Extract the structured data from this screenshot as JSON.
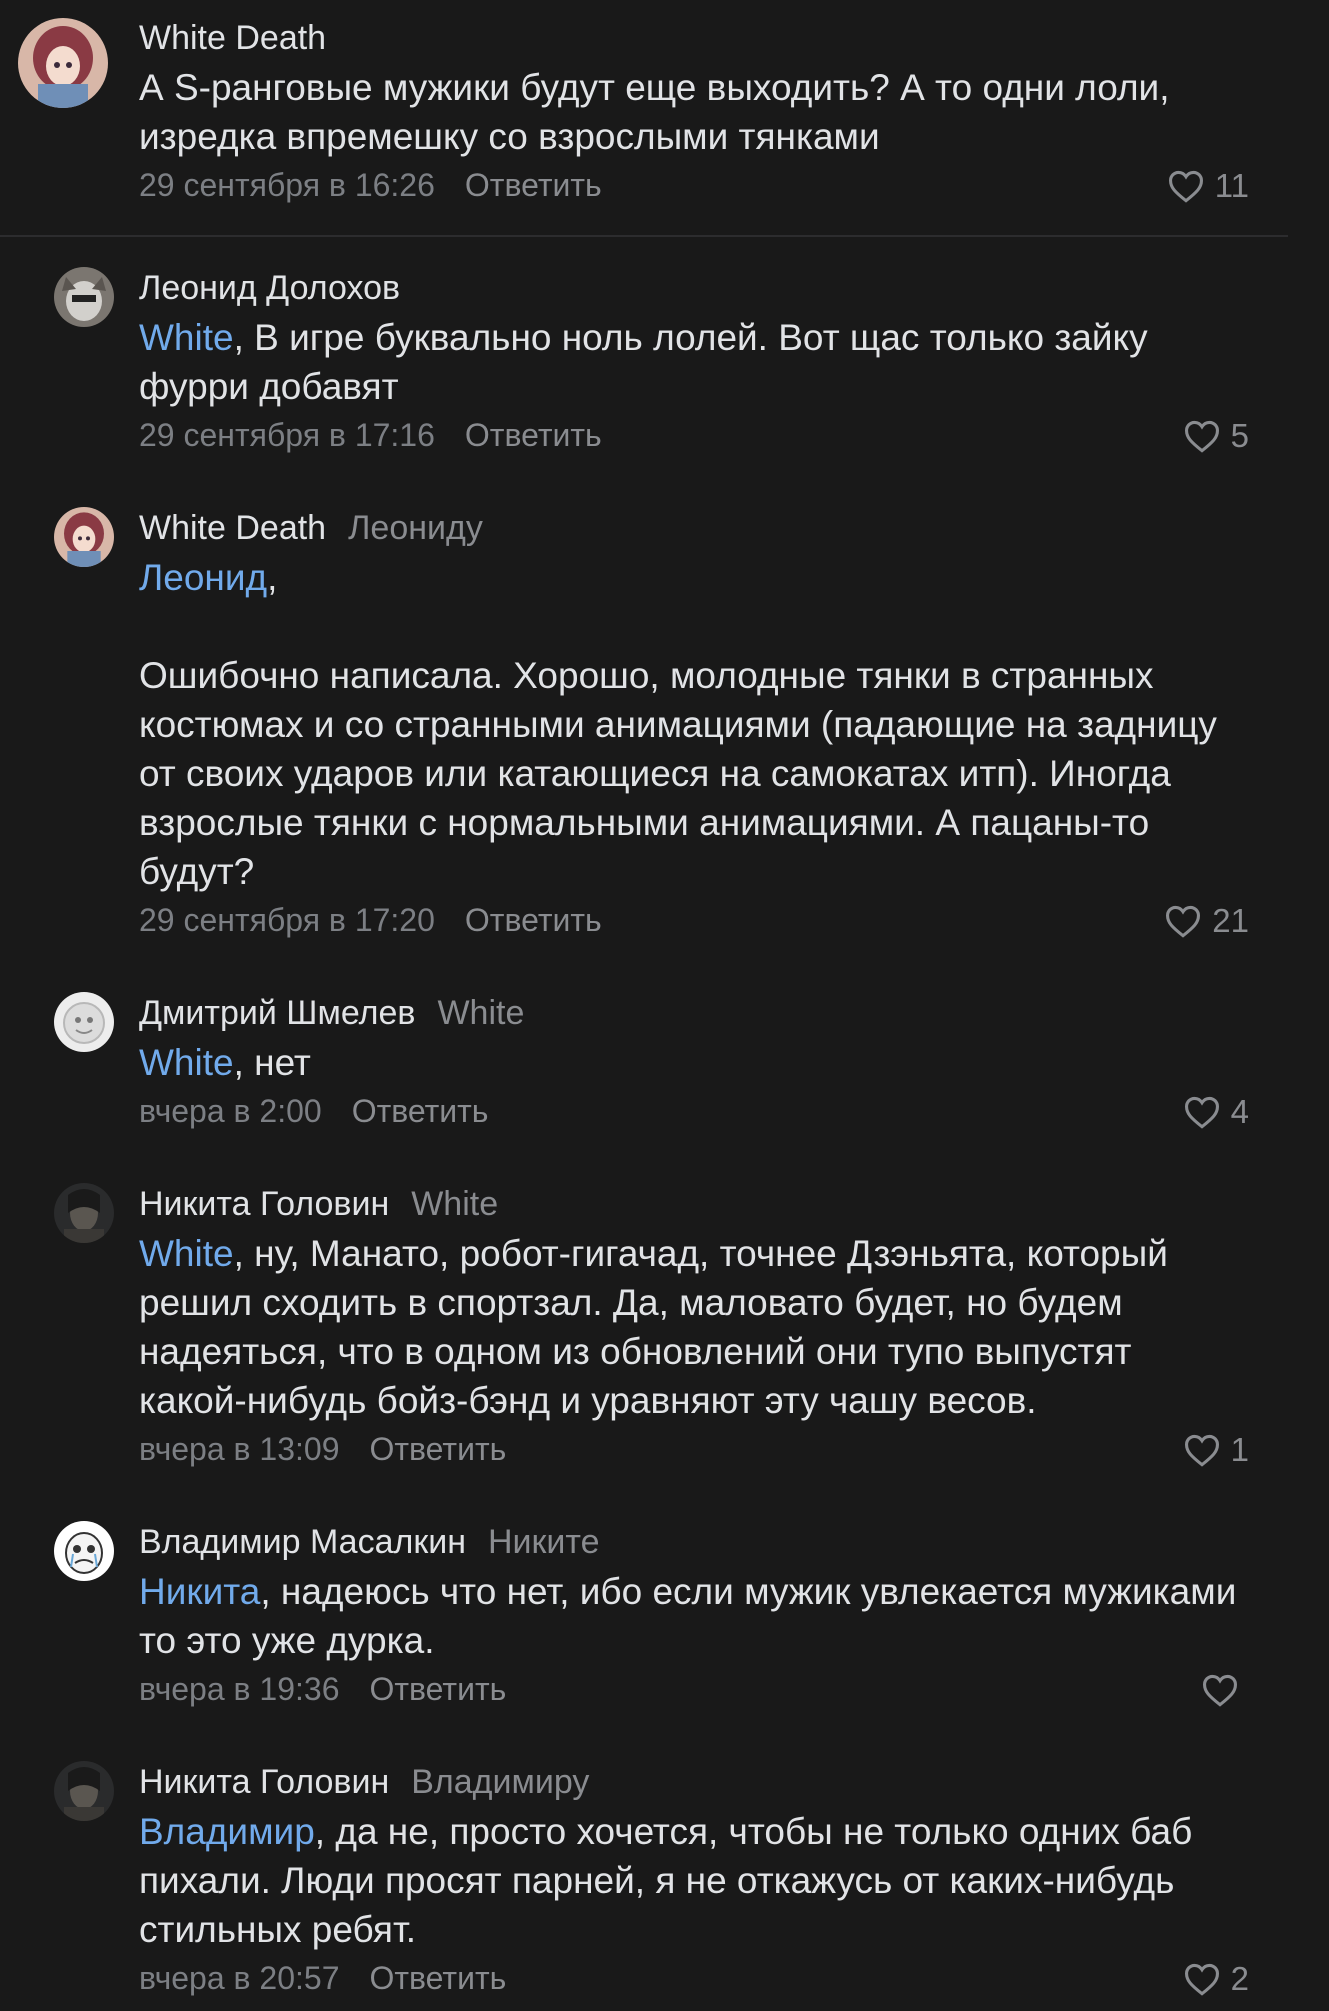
{
  "comments": [
    {
      "author": "White Death",
      "reply_to": "",
      "mention": "",
      "text": "А S-ранговые мужики будут еще выходить? А то одни лоли, изредка впремешку со взрослыми тянками",
      "date": "29 сентября в 16:26",
      "reply_label": "Ответить",
      "likes": "11"
    },
    {
      "author": "Леонид Долохов",
      "reply_to": "",
      "mention": "White",
      "text": ", В игре буквально ноль лолей. Вот щас только зайку фурри добавят",
      "date": "29 сентября в 17:16",
      "reply_label": "Ответить",
      "likes": "5"
    },
    {
      "author": "White Death",
      "reply_to": "Леониду",
      "mention": "Леонид",
      "text": ",\n\nОшибочно написала. Хорошо, молодные тянки в странных костюмах и со странными анимациями (падающие на задницу от своих ударов или катающиеся на самокатах итп). Иногда взрослые тянки с нормальными анимациями. А пацаны-то будут?",
      "date": "29 сентября в 17:20",
      "reply_label": "Ответить",
      "likes": "21"
    },
    {
      "author": "Дмитрий Шмелев",
      "reply_to": "White",
      "mention": "White",
      "text": ", нет",
      "date": "вчера в 2:00",
      "reply_label": "Ответить",
      "likes": "4"
    },
    {
      "author": "Никита Головин",
      "reply_to": "White",
      "mention": "White",
      "text": ", ну, Манато, робот-гигачад, точнее Дзэньята, который решил сходить в спортзал. Да, маловато будет, но будем надеяться, что в одном из обновлений они тупо выпустят какой-нибудь бойз-бэнд и уравняют эту чашу весов.",
      "date": "вчера в 13:09",
      "reply_label": "Ответить",
      "likes": "1"
    },
    {
      "author": "Владимир Масалкин",
      "reply_to": "Никите",
      "mention": "Никита",
      "text": ", надеюсь что нет, ибо если мужик увлекается мужиками то это уже дурка.",
      "date": "вчера в 19:36",
      "reply_label": "Ответить",
      "likes": ""
    },
    {
      "author": "Никита Головин",
      "reply_to": "Владимиру",
      "mention": "Владимир",
      "text": ", да не, просто хочется, чтобы не только одних баб пихали. Люди просят парней, я не откажусь от каких-нибудь стильных ребят.",
      "date": "вчера в 20:57",
      "reply_label": "Ответить",
      "likes": "2"
    }
  ],
  "icons": {
    "like": "heart-icon"
  },
  "colors": {
    "background": "#191919",
    "text": "#e1e3e6",
    "mention": "#71aaeb",
    "secondary": "#7c7f84"
  }
}
